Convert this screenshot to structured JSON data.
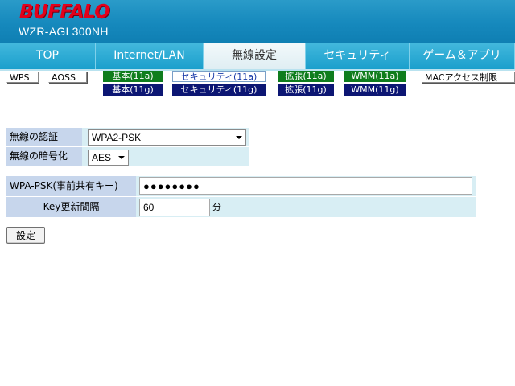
{
  "header": {
    "logo": "BUFFALO",
    "model": "WZR-AGL300NH"
  },
  "tabs": [
    {
      "label": "TOP"
    },
    {
      "label": "Internet/LAN"
    },
    {
      "label": "無線設定"
    },
    {
      "label": "セキュリティ"
    },
    {
      "label": "ゲーム＆アプリ"
    }
  ],
  "subnav": {
    "wps": "WPS",
    "aoss": "AOSS",
    "basic_11a": "基本(11a)",
    "basic_11g": "基本(11g)",
    "security_11a": "セキュリティ(11a)",
    "security_11g": "セキュリティ(11g)",
    "ext_11a": "拡張(11a)",
    "ext_11g": "拡張(11g)",
    "wmm_11a": "WMM(11a)",
    "wmm_11g": "WMM(11g)",
    "mac_access": "MACアクセス制限"
  },
  "wireless": {
    "auth_label": "無線の認証",
    "auth_value": "WPA2-PSK",
    "encryption_label": "無線の暗号化",
    "encryption_value": "AES"
  },
  "psk": {
    "key_label": "WPA-PSK(事前共有キー)",
    "key_value": "●●●●●●●●",
    "interval_label": "Key更新間隔",
    "interval_value": "60",
    "interval_unit": "分"
  },
  "actions": {
    "submit_label": "設定"
  },
  "colors": {
    "header_blue": "#1689bd",
    "logo_red": "#e3001b",
    "sub_green": "#0f7d1d",
    "sub_navy": "#0c1673",
    "label_bg": "#c7d6ec",
    "value_bg": "#d8eef4"
  }
}
